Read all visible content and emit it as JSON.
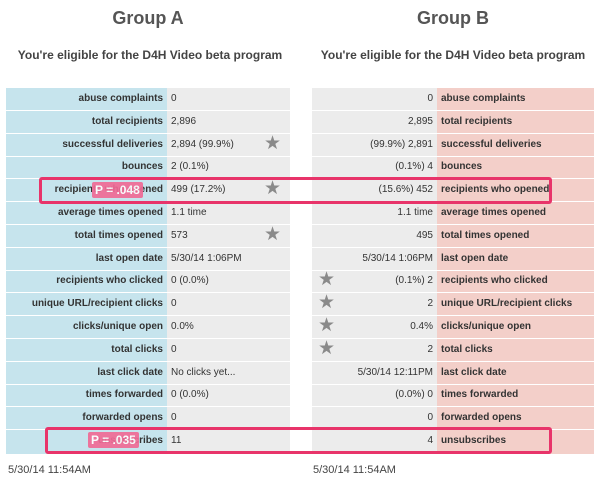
{
  "groups": [
    {
      "title": "Group A",
      "subtitle": "You're eligible for the D4H Video beta program",
      "footer_date": "5/30/14 11:54AM",
      "rows": [
        {
          "label": "abuse complaints",
          "value": "0",
          "star": false
        },
        {
          "label": "total recipients",
          "value": "2,896",
          "star": false
        },
        {
          "label": "successful deliveries",
          "value": "2,894 (99.9%)",
          "star": true
        },
        {
          "label": "bounces",
          "value": "2 (0.1%)",
          "star": false
        },
        {
          "label": "recipients who opened",
          "value": "499 (17.2%)",
          "star": true
        },
        {
          "label": "average times opened",
          "value": "1.1 time",
          "star": false
        },
        {
          "label": "total times opened",
          "value": "573",
          "star": true
        },
        {
          "label": "last open date",
          "value": "5/30/14 1:06PM",
          "star": false
        },
        {
          "label": "recipients who clicked",
          "value": "0 (0.0%)",
          "star": false
        },
        {
          "label": "unique URL/recipient clicks",
          "value": "0",
          "star": false
        },
        {
          "label": "clicks/unique open",
          "value": "0.0%",
          "star": false
        },
        {
          "label": "total clicks",
          "value": "0",
          "star": false
        },
        {
          "label": "last click date",
          "value": "No clicks yet...",
          "star": false
        },
        {
          "label": "times forwarded",
          "value": "0 (0.0%)",
          "star": false
        },
        {
          "label": "forwarded opens",
          "value": "0",
          "star": false
        },
        {
          "label": "unsubscribes",
          "value": "11",
          "star": false
        }
      ]
    },
    {
      "title": "Group B",
      "subtitle": "You're eligible for the D4H Video beta program",
      "footer_date": "5/30/14 11:54AM",
      "rows": [
        {
          "label": "abuse complaints",
          "value": "0",
          "star": false
        },
        {
          "label": "total recipients",
          "value": "2,895",
          "star": false
        },
        {
          "label": "successful deliveries",
          "value": "(99.9%) 2,891",
          "star": false
        },
        {
          "label": "bounces",
          "value": "(0.1%) 4",
          "star": false
        },
        {
          "label": "recipients who opened",
          "value": "(15.6%) 452",
          "star": false
        },
        {
          "label": "average times opened",
          "value": "1.1 time",
          "star": false
        },
        {
          "label": "total times opened",
          "value": "495",
          "star": false
        },
        {
          "label": "last open date",
          "value": "5/30/14 1:06PM",
          "star": false
        },
        {
          "label": "recipients who clicked",
          "value": "(0.1%) 2",
          "star": true
        },
        {
          "label": "unique URL/recipient clicks",
          "value": "2",
          "star": true
        },
        {
          "label": "clicks/unique open",
          "value": "0.4%",
          "star": true
        },
        {
          "label": "total clicks",
          "value": "2",
          "star": true
        },
        {
          "label": "last click date",
          "value": "5/30/14 12:11PM",
          "star": false
        },
        {
          "label": "times forwarded",
          "value": "(0.0%) 0",
          "star": false
        },
        {
          "label": "forwarded opens",
          "value": "0",
          "star": false
        },
        {
          "label": "unsubscribes",
          "value": "4",
          "star": false
        }
      ]
    }
  ],
  "annotations": [
    {
      "text": "P = .048"
    },
    {
      "text": "P = .035"
    }
  ],
  "colors": {
    "group_a_label_bg": "#c6e4ed",
    "group_b_label_bg": "#f3cfc9",
    "value_bg": "#ececec",
    "highlight": "#e8346a",
    "star": "#8a8a8a"
  },
  "icons": {
    "star": "★"
  }
}
